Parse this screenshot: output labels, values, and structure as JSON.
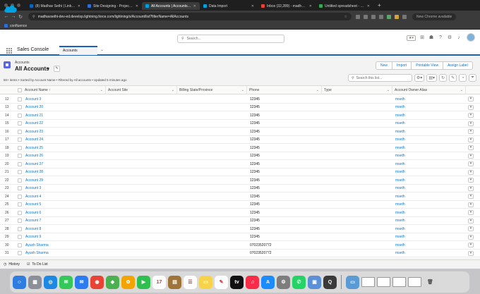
{
  "browser": {
    "tabs": [
      {
        "title": "(8) Madhav Sethi | LinkedIn",
        "color": "#0a66c2",
        "active": false
      },
      {
        "title": "Site Designing - Project ma...",
        "color": "#2d6fd6",
        "active": false
      },
      {
        "title": "All Accounts | Accounts | Sal...",
        "color": "#00a1e0",
        "active": true
      },
      {
        "title": "Data Import",
        "color": "#00a1e0",
        "active": false
      },
      {
        "title": "Inbox (32,289) - madhav.se...",
        "color": "#ea4335",
        "active": false
      },
      {
        "title": "Untitled spreadsheet - Goog...",
        "color": "#34a853",
        "active": false
      }
    ],
    "url": "madhavsethi-dev-ed.develop.lightning.force.com/lightning/o/Account/list?filterName=AllAccounts",
    "bookmark": "confluence",
    "conversation_button": "New Chrome available"
  },
  "header": {
    "search_placeholder": "Search...",
    "app_name": "Sales Console",
    "nav_tab": "Accounts"
  },
  "listview": {
    "object_label": "Accounts",
    "view_name": "All Accounts",
    "buttons": [
      "New",
      "Import",
      "Printable View",
      "Assign Label"
    ],
    "meta": "50+ items • Sorted by Account Name • Filtered by All accounts • Updated 5 minutes ago",
    "search_placeholder": "Search this list..."
  },
  "table": {
    "columns": [
      "Account Name",
      "Account Site",
      "Billing State/Province",
      "Phone",
      "Type",
      "Account Owner Alias"
    ],
    "sort_indicator": "↑",
    "rows": [
      {
        "n": "12",
        "name": "Account 3",
        "phone": "12345",
        "owner": "mseth"
      },
      {
        "n": "13",
        "name": "Account 20",
        "phone": "12345",
        "owner": "mseth"
      },
      {
        "n": "14",
        "name": "Account 21",
        "phone": "12345",
        "owner": "mseth"
      },
      {
        "n": "15",
        "name": "Account 22",
        "phone": "12345",
        "owner": "mseth"
      },
      {
        "n": "16",
        "name": "Account 23",
        "phone": "12345",
        "owner": "mseth"
      },
      {
        "n": "17",
        "name": "Account 24",
        "phone": "12345",
        "owner": "mseth"
      },
      {
        "n": "18",
        "name": "Account 25",
        "phone": "12345",
        "owner": "mseth"
      },
      {
        "n": "19",
        "name": "Account 26",
        "phone": "12345",
        "owner": "mseth"
      },
      {
        "n": "20",
        "name": "Account 27",
        "phone": "12345",
        "owner": "mseth"
      },
      {
        "n": "21",
        "name": "Account 28",
        "phone": "12345",
        "owner": "mseth"
      },
      {
        "n": "22",
        "name": "Account 29",
        "phone": "12345",
        "owner": "mseth"
      },
      {
        "n": "23",
        "name": "Account 3",
        "phone": "12345",
        "owner": "mseth"
      },
      {
        "n": "24",
        "name": "Account 4",
        "phone": "12345",
        "owner": "mseth"
      },
      {
        "n": "25",
        "name": "Account 5",
        "phone": "12345",
        "owner": "mseth"
      },
      {
        "n": "26",
        "name": "Account 6",
        "phone": "12345",
        "owner": "mseth"
      },
      {
        "n": "27",
        "name": "Account 7",
        "phone": "12345",
        "owner": "mseth"
      },
      {
        "n": "28",
        "name": "Account 8",
        "phone": "12345",
        "owner": "mseth"
      },
      {
        "n": "29",
        "name": "Account 9",
        "phone": "12345",
        "owner": "mseth"
      },
      {
        "n": "30",
        "name": "Ayush Sharma",
        "phone": "07023520772",
        "owner": "mseth"
      },
      {
        "n": "31",
        "name": "Ayush Sharma",
        "phone": "07023520772",
        "owner": "mseth"
      }
    ]
  },
  "utility": {
    "history": "History",
    "todo": "To Do List"
  },
  "dock": {
    "apps": [
      {
        "name": "finder",
        "color": "#2f7de1",
        "glyph": "☺"
      },
      {
        "name": "launchpad",
        "color": "#8a8f99",
        "glyph": "▦"
      },
      {
        "name": "safari",
        "color": "#1e88e5",
        "glyph": "◎"
      },
      {
        "name": "messages",
        "color": "#34c759",
        "glyph": "✉"
      },
      {
        "name": "mail",
        "color": "#2b7cf0",
        "glyph": "✉"
      },
      {
        "name": "chrome",
        "color": "#e84335",
        "glyph": "◉"
      },
      {
        "name": "maps",
        "color": "#4caf50",
        "glyph": "◆"
      },
      {
        "name": "photos",
        "color": "#f4a300",
        "glyph": "✿"
      },
      {
        "name": "facetime",
        "color": "#2fbf4f",
        "glyph": "▶"
      },
      {
        "name": "calendar",
        "color": "#ffffff",
        "glyph": "17"
      },
      {
        "name": "notes-brown",
        "color": "#a0733a",
        "glyph": "▤"
      },
      {
        "name": "reminders",
        "color": "#ffffff",
        "glyph": "☰"
      },
      {
        "name": "notes",
        "color": "#f6d34a",
        "glyph": "▭"
      },
      {
        "name": "freeform",
        "color": "#ffffff",
        "glyph": "✎"
      },
      {
        "name": "tv",
        "color": "#111111",
        "glyph": "tv"
      },
      {
        "name": "music",
        "color": "#fa2d48",
        "glyph": "♫"
      },
      {
        "name": "app-store",
        "color": "#1a8cff",
        "glyph": "A"
      },
      {
        "name": "system-settings",
        "color": "#7d7d7d",
        "glyph": "⚙"
      },
      {
        "name": "whatsapp",
        "color": "#25d366",
        "glyph": "✆"
      },
      {
        "name": "preview",
        "color": "#5b8fd8",
        "glyph": "▣"
      },
      {
        "name": "quicktime",
        "color": "#3a3a3a",
        "glyph": "Q"
      }
    ]
  }
}
